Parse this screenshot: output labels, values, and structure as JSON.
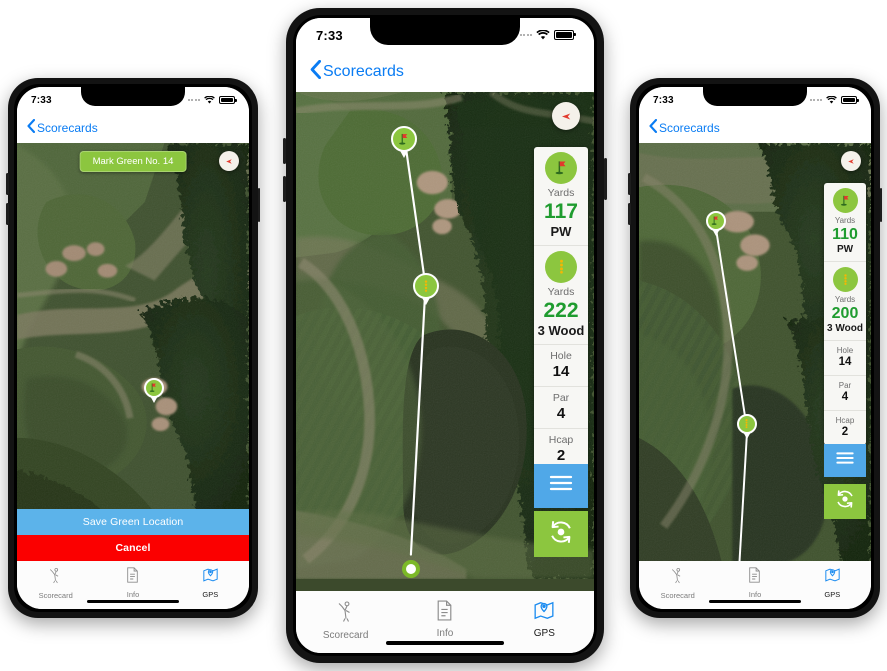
{
  "app": {
    "status_time": "7:33",
    "back_label": "Scorecards",
    "colors": {
      "accent_blue": "#0a7cf3",
      "green": "#8cc63f",
      "value_green": "#1f9c2f",
      "save_blue": "#5cb3ea",
      "cancel_red": "#fb0000",
      "menu_blue": "#50a8e8"
    },
    "tabs": [
      {
        "label": "Scorecard",
        "icon": "golfer-icon",
        "active": false
      },
      {
        "label": "Info",
        "icon": "document-icon",
        "active": false
      },
      {
        "label": "GPS",
        "icon": "map-pin-icon",
        "active": true
      }
    ]
  },
  "phone_left": {
    "status_time": "7:33",
    "back_label": "Scorecards",
    "banner_label": "Mark Green No. 14",
    "compass_icon": "compass-needle-icon",
    "buttons": {
      "save_label": "Save Green Location",
      "cancel_label": "Cancel"
    },
    "markers": [
      {
        "name": "green-pin",
        "icon": "flag-icon"
      }
    ]
  },
  "phone_center": {
    "status_time": "7:33",
    "back_label": "Scorecards",
    "compass_icon": "compass-needle-icon",
    "panel": {
      "green": {
        "icon": "flag-icon",
        "label": "Yards",
        "value": "117",
        "club": "PW"
      },
      "layup": {
        "icon": "layup-dots-icon",
        "label": "Yards",
        "value": "222",
        "club": "3 Wood"
      },
      "hole": {
        "label": "Hole",
        "value": "14"
      },
      "par": {
        "label": "Par",
        "value": "4"
      },
      "hcap": {
        "label": "Hcap",
        "value": "2"
      }
    },
    "menu_button_icon": "hamburger-menu-icon",
    "gps_button_icon": "gps-refresh-icon",
    "markers": [
      {
        "name": "green-pin",
        "icon": "flag-icon"
      },
      {
        "name": "layup-pin",
        "icon": "layup-dots-icon"
      },
      {
        "name": "ball-position-marker",
        "icon": "ball-circle-icon"
      }
    ]
  },
  "phone_right": {
    "status_time": "7:33",
    "back_label": "Scorecards",
    "compass_icon": "compass-needle-icon",
    "panel": {
      "green": {
        "icon": "flag-icon",
        "label": "Yards",
        "value": "110",
        "club": "PW"
      },
      "layup": {
        "icon": "layup-dots-icon",
        "label": "Yards",
        "value": "200",
        "club": "3 Wood"
      },
      "hole": {
        "label": "Hole",
        "value": "14"
      },
      "par": {
        "label": "Par",
        "value": "4"
      },
      "hcap": {
        "label": "Hcap",
        "value": "2"
      }
    },
    "menu_button_icon": "hamburger-menu-icon",
    "gps_button_icon": "gps-refresh-icon",
    "markers": [
      {
        "name": "green-pin",
        "icon": "flag-icon"
      },
      {
        "name": "layup-pin",
        "icon": "layup-dots-icon"
      }
    ]
  }
}
